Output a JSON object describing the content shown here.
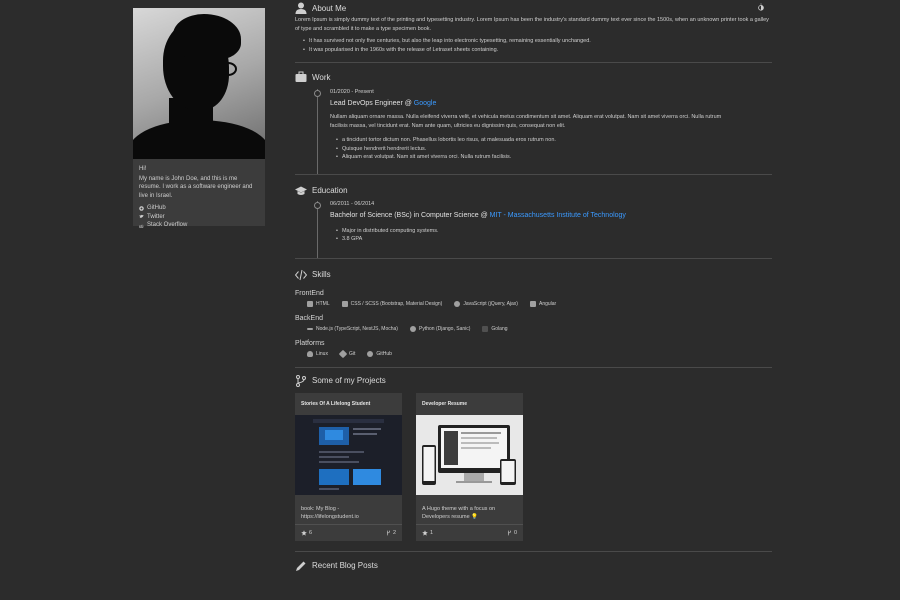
{
  "profile": {
    "greeting": "Hi!",
    "bio": "My name is John Doe, and this is me resume. I work as a software engineer and live in Israel.",
    "social": [
      {
        "icon": "github-icon",
        "label": "GitHub"
      },
      {
        "icon": "twitter-icon",
        "label": "Twitter"
      },
      {
        "icon": "stackoverflow-icon",
        "label": "Stack Overflow"
      }
    ]
  },
  "about": {
    "title": "About Me",
    "text": "Lorem Ipsum is simply dummy text of the printing and typesetting industry. Lorem Ipsum has been the industry's standard dummy text ever since the 1500s, when an unknown printer took a galley of type and scrambled it to make a type specimen book.",
    "bullets": [
      "It has survived not only five centuries, but also the leap into electronic typesetting, remaining essentially unchanged.",
      "It was popularised in the 1960s with the release of Letraset sheets containing."
    ]
  },
  "work": {
    "title": "Work",
    "date": "01/2020 - Present",
    "role": "Lead DevOps Engineer @ ",
    "company": "Google",
    "text": "Nullam aliquam ornare massa. Nulla eleifend viverra velit, et vehicula metus condimentum sit amet. Aliquam erat volutpat. Nam sit amet viverra orci. Nulla rutrum facilisis massa, vel tincidunt erat. Nam ante quam, ultricies eu dignissim quis, consequat non elit.",
    "bullets": [
      "a tincidunt tortor dictum non. Phasellus lobortis leo risus, at malesuada eros rutrum non.",
      "Quisque hendrerit hendrerit lectus.",
      "Aliquam erat volutpat. Nam sit amet viverra orci. Nulla rutrum facilisis."
    ]
  },
  "education": {
    "title": "Education",
    "date": "06/2011 - 06/2014",
    "degree": "Bachelor of Science (BSc) in Computer Science @ ",
    "school": "MIT - Massachusetts Institute of Technology",
    "bullets": [
      "Major in distributed computing systems.",
      "3.8 GPA"
    ]
  },
  "skills": {
    "title": "Skills",
    "groups": [
      {
        "name": "FrontEnd",
        "items": [
          "HTML",
          "CSS / SCSS (Bootstrap, Material Design)",
          "JavaScript (jQuery, Ajax)",
          "Angular"
        ]
      },
      {
        "name": "BackEnd",
        "items": [
          "Node.js (TypeScript, NestJS, Mocha)",
          "Python (Django, Sanic)",
          "Golang"
        ]
      },
      {
        "name": "Platforms",
        "items": [
          "Linux",
          "Git",
          "GitHub"
        ]
      }
    ]
  },
  "projects": {
    "title": "Some of my Projects",
    "items": [
      {
        "name": "Stories Of A Lifelong Student",
        "desc": "book: My Blog - https://lifelongstudent.io",
        "stars": "6",
        "forks": "2"
      },
      {
        "name": "Developer Resume",
        "desc": "A Hugo theme with a focus on Developers resume 💡",
        "stars": "1",
        "forks": "0"
      }
    ]
  },
  "blog": {
    "title": "Recent Blog Posts"
  }
}
